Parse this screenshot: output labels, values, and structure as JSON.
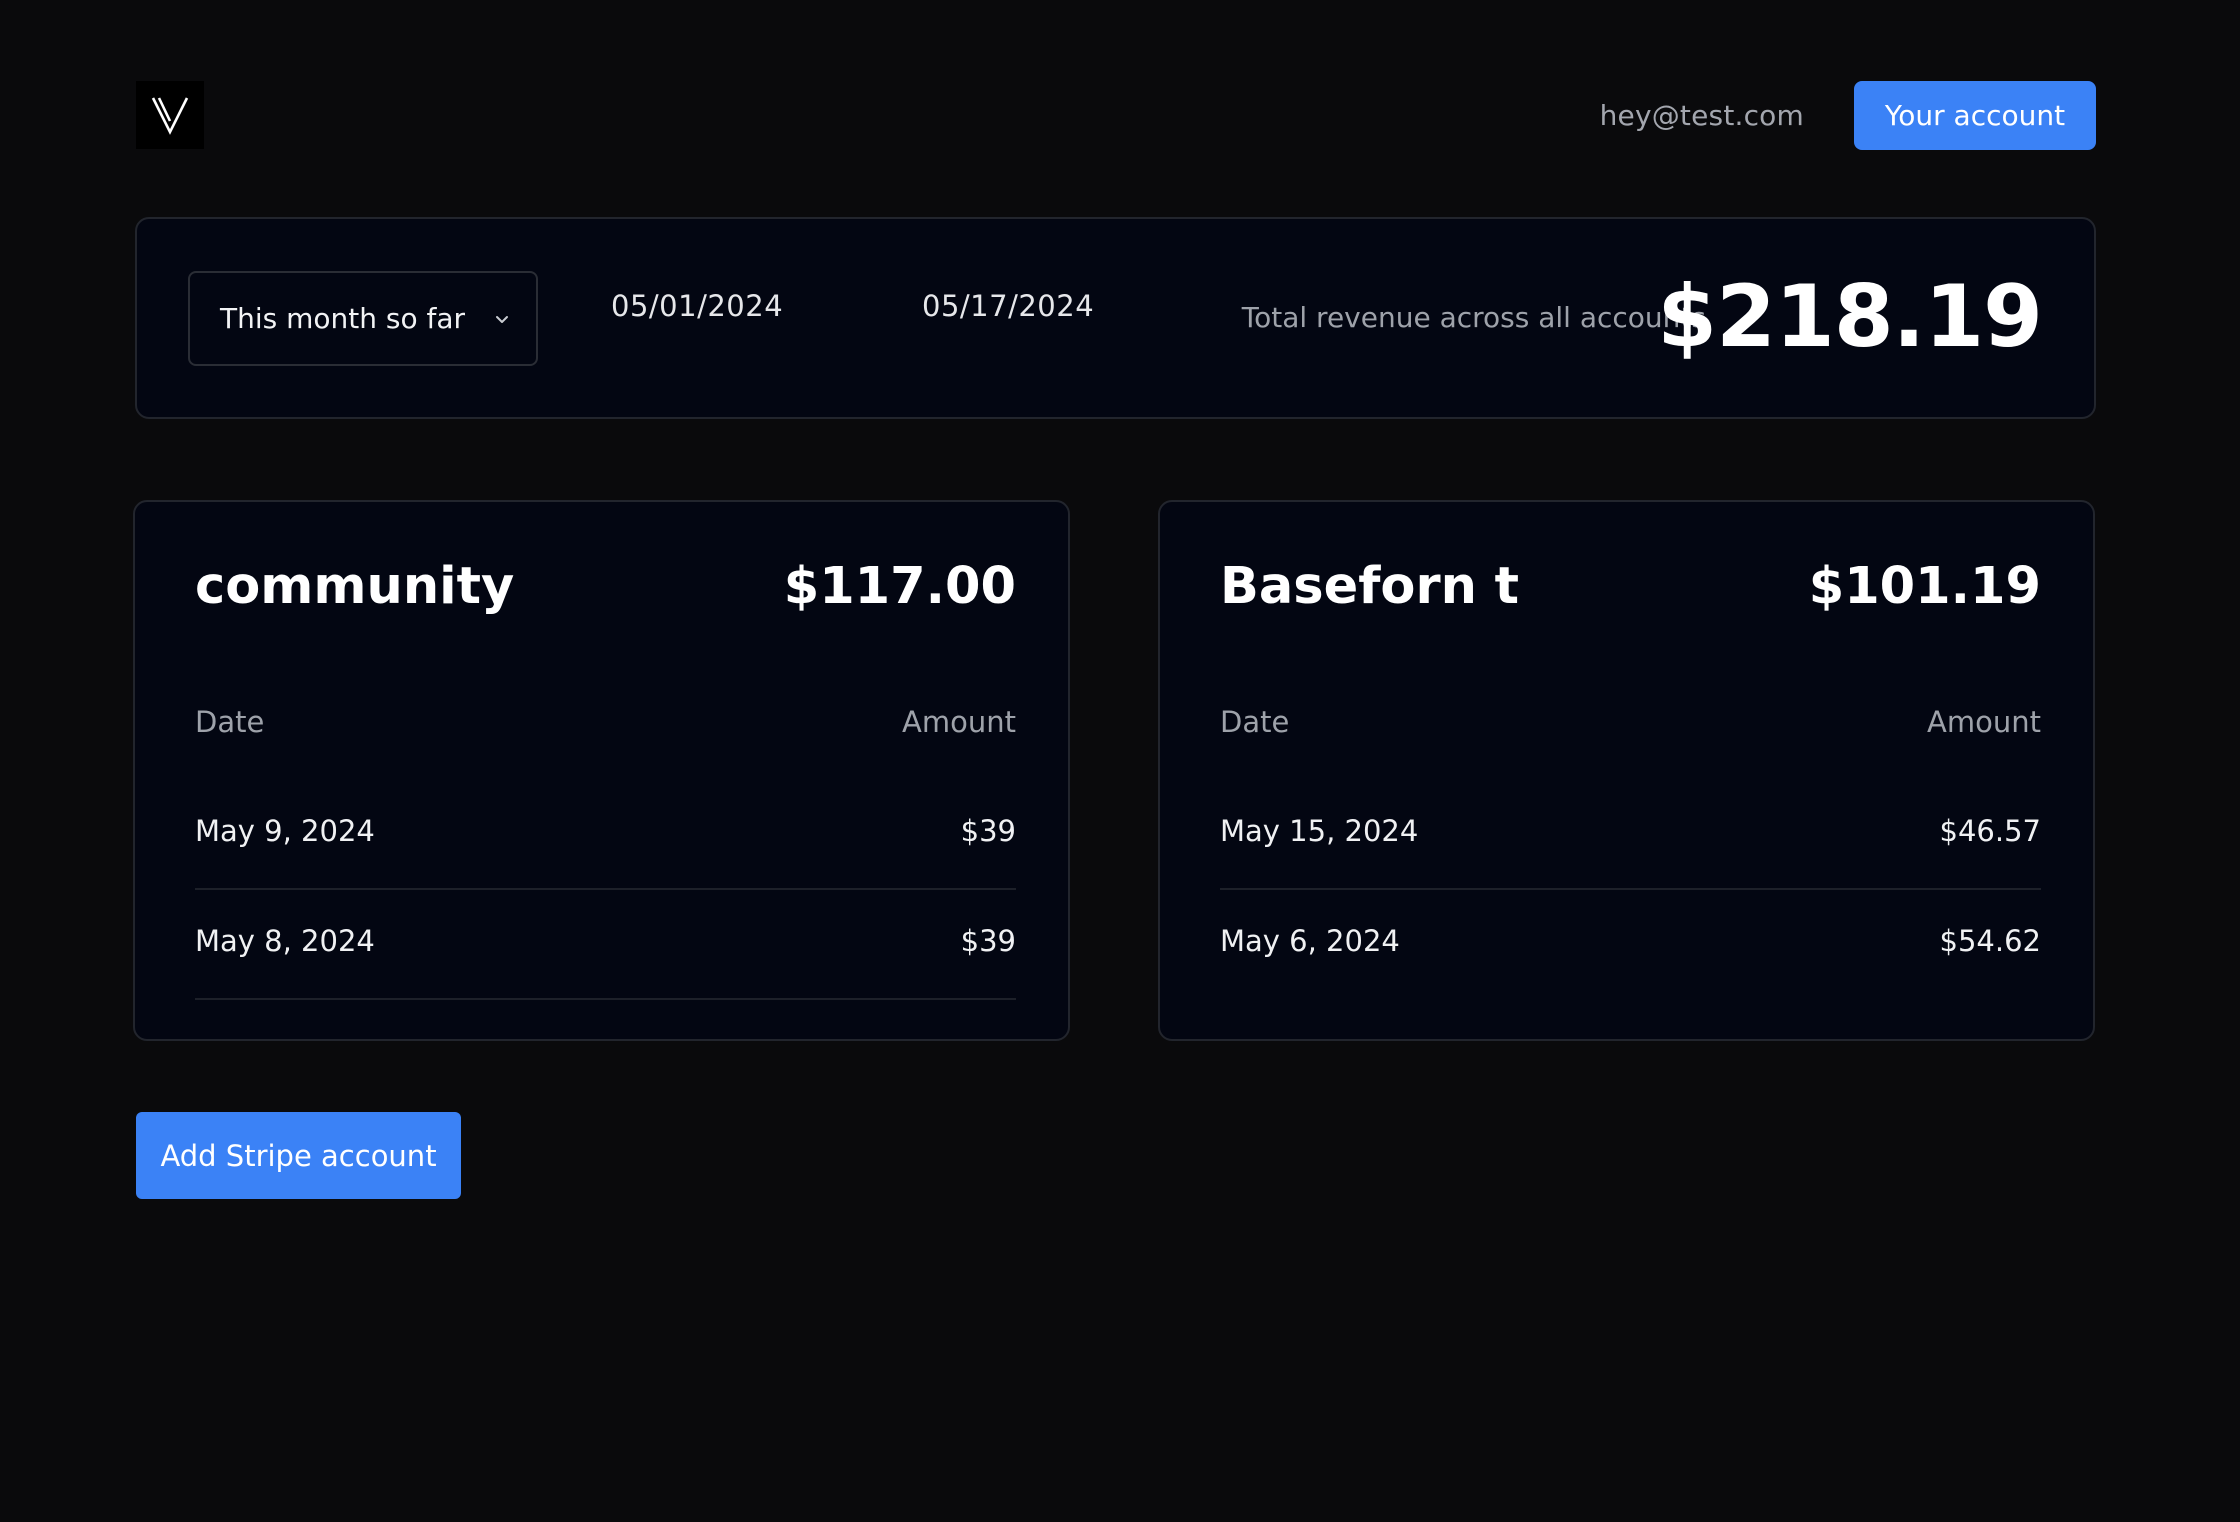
{
  "header": {
    "logo_icon": "v-logo-icon",
    "user_email": "hey@test.com",
    "account_button_label": "Your account"
  },
  "summary": {
    "range_select": {
      "selected": "This month so far",
      "icon": "chevron-down-icon"
    },
    "start_date": "05/01/2024",
    "end_date": "05/17/2024",
    "total_label": "Total revenue across all accounts",
    "total_value": "$218.19"
  },
  "accounts": [
    {
      "name": "community",
      "total": "$117.00",
      "columns": {
        "date": "Date",
        "amount": "Amount"
      },
      "transactions": [
        {
          "date": "May 9, 2024",
          "amount": "$39"
        },
        {
          "date": "May 8, 2024",
          "amount": "$39"
        }
      ]
    },
    {
      "name": "Baseforn t",
      "total": "$101.19",
      "columns": {
        "date": "Date",
        "amount": "Amount"
      },
      "transactions": [
        {
          "date": "May 15, 2024",
          "amount": "$46.57"
        },
        {
          "date": "May 6, 2024",
          "amount": "$54.62"
        }
      ]
    }
  ],
  "actions": {
    "add_stripe_label": "Add Stripe account"
  },
  "colors": {
    "background": "#0a0a0c",
    "card": "#030612",
    "accent": "#3b82f6",
    "border": "#22252d",
    "muted_text": "#9ea2aa"
  }
}
